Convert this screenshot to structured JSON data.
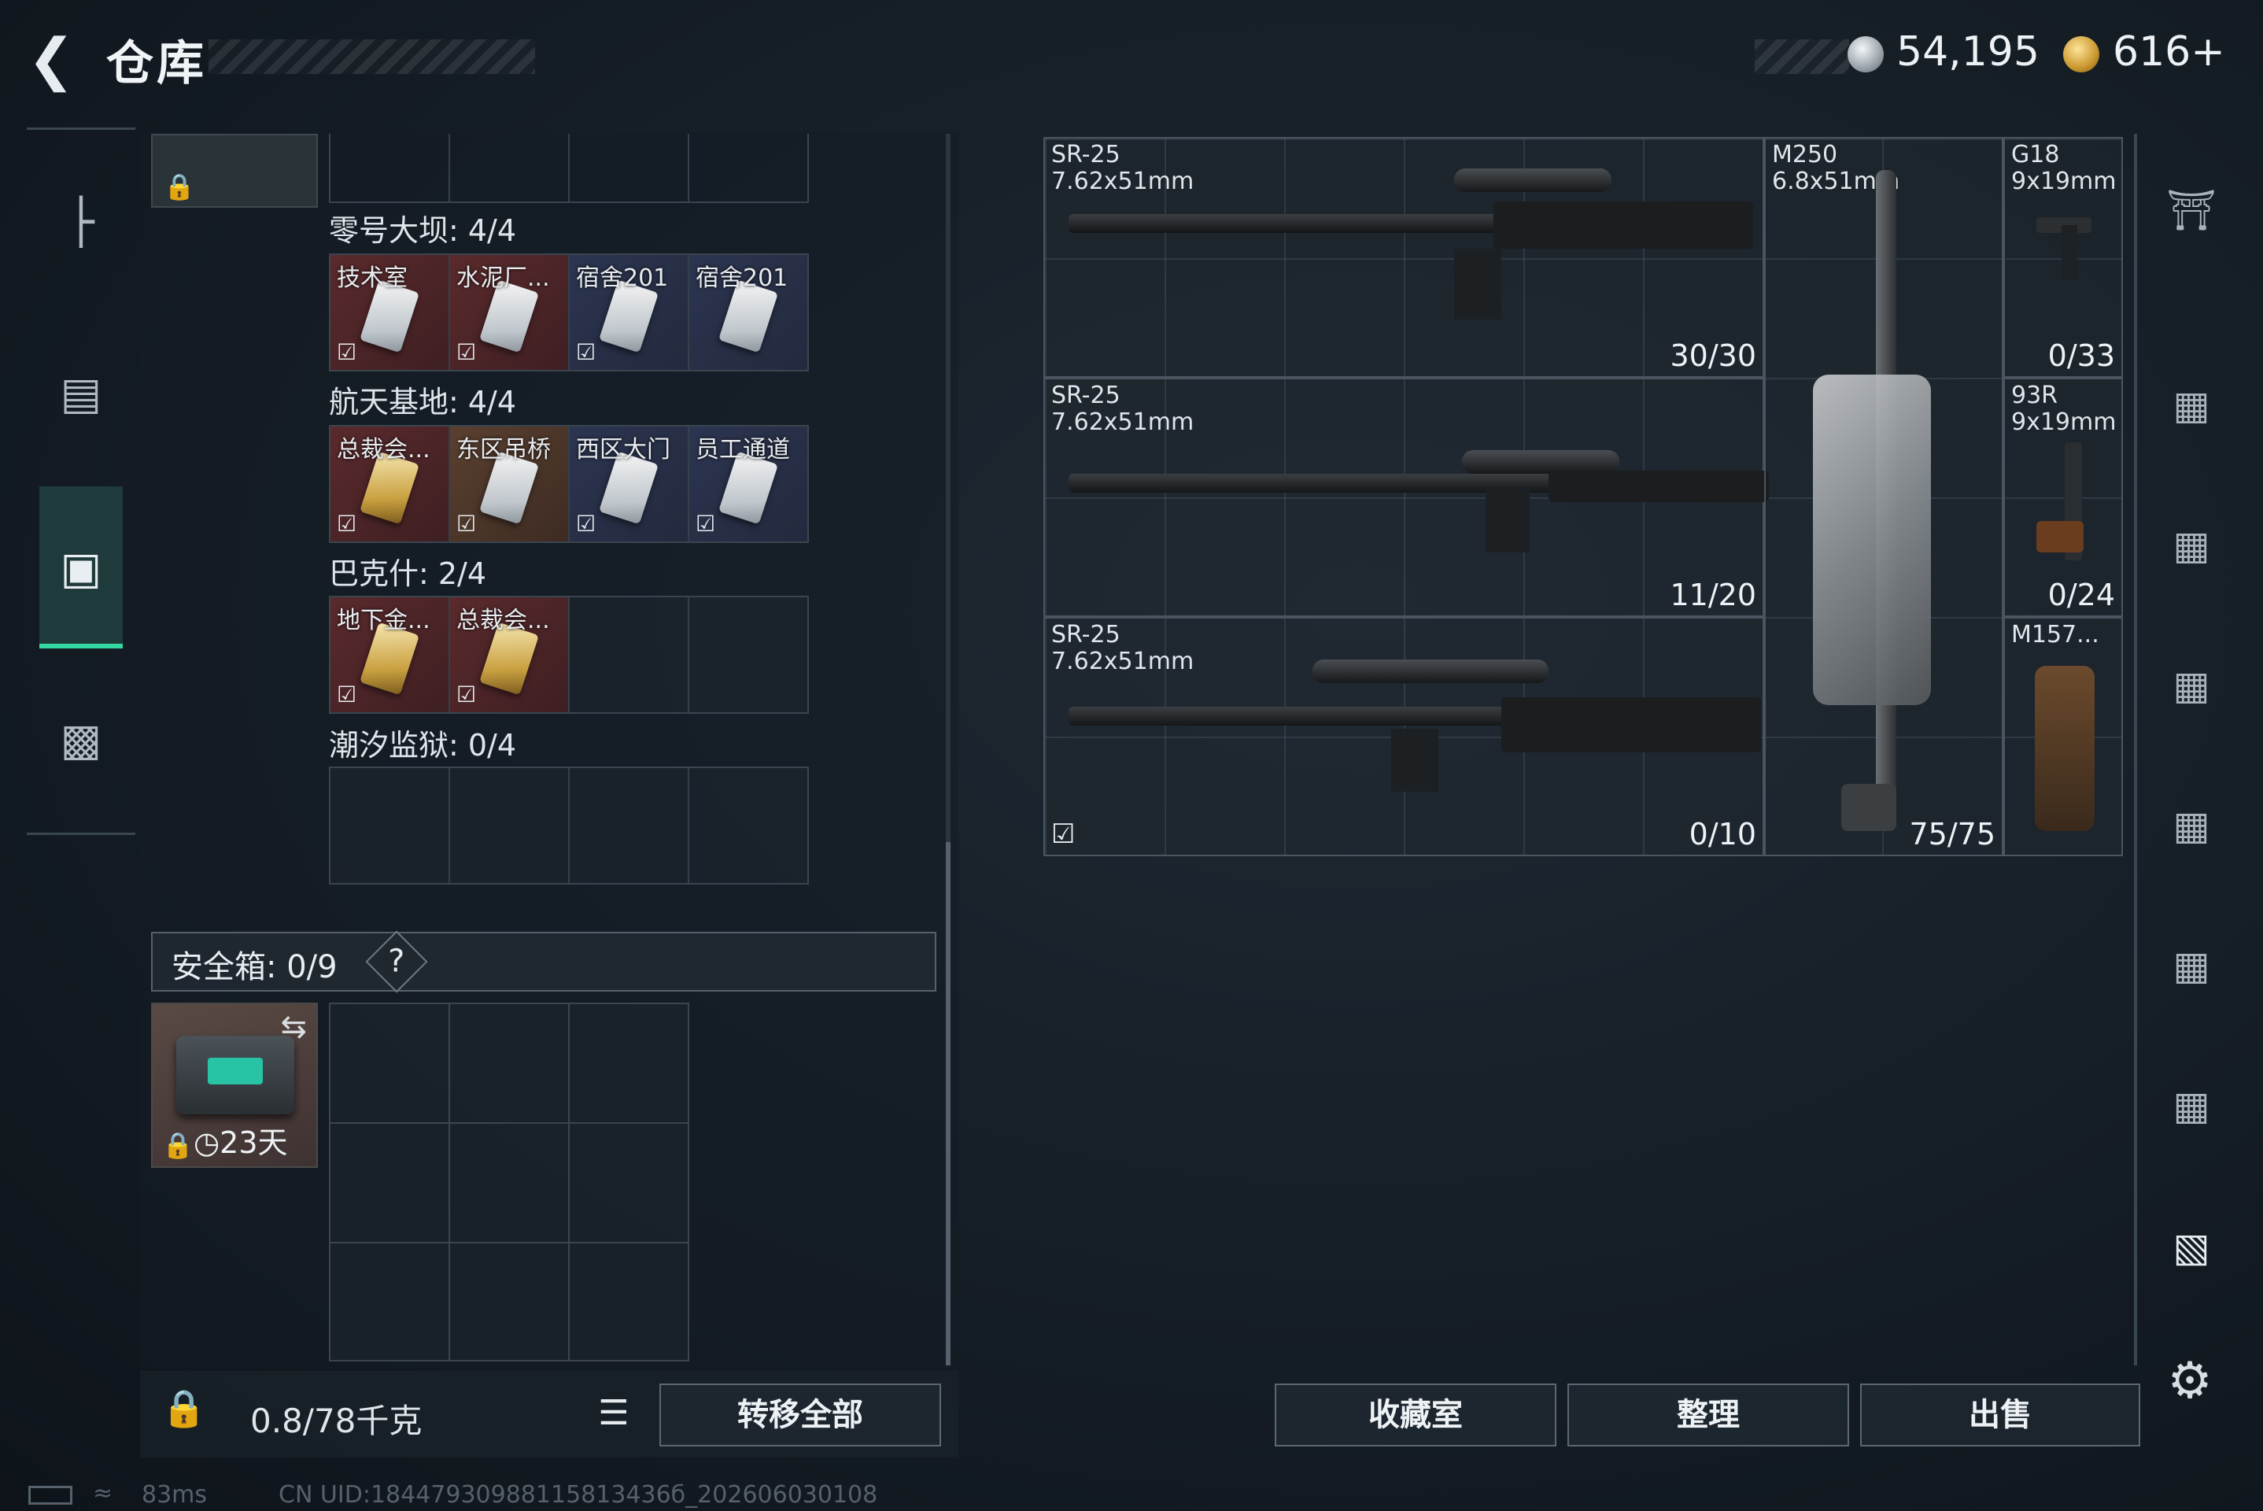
{
  "header": {
    "back_icon": "back-arrow-icon",
    "title": "仓库",
    "currency_silver": "54,195",
    "currency_gold": "616+"
  },
  "left_nav": {
    "items": [
      {
        "icon": "gun-icon"
      },
      {
        "icon": "backpack-icon"
      },
      {
        "icon": "case-icon",
        "active": true
      },
      {
        "icon": "briefcase-icon"
      }
    ]
  },
  "keycards": {
    "sections": [
      {
        "title": "零号大坝: 4/4",
        "cards": [
          {
            "label": "技术室",
            "tone": "red"
          },
          {
            "label": "水泥厂...",
            "tone": "red"
          },
          {
            "label": "宿舍201",
            "tone": "blue"
          },
          {
            "label": "宿舍201",
            "tone": "blue"
          }
        ]
      },
      {
        "title": "航天基地: 4/4",
        "cards": [
          {
            "label": "总裁会...",
            "tone": "red",
            "gold": true
          },
          {
            "label": "东区吊桥",
            "tone": "brown"
          },
          {
            "label": "西区大门",
            "tone": "blue"
          },
          {
            "label": "员工通道",
            "tone": "blue"
          }
        ]
      },
      {
        "title": "巴克什: 2/4",
        "cards": [
          {
            "label": "地下金...",
            "tone": "red",
            "gold": true
          },
          {
            "label": "总裁会...",
            "tone": "red",
            "gold": true
          }
        ]
      },
      {
        "title": "潮汐监狱: 0/4",
        "cards": []
      }
    ]
  },
  "safe": {
    "label": "安全箱:",
    "count": "0/9",
    "help": "?",
    "timer": "23天"
  },
  "bottom_left": {
    "weight": "0.8/78千克",
    "transfer_all": "转移全部"
  },
  "weapons": [
    {
      "name": "SR-25",
      "caliber": "7.62x51mm",
      "ammo": "30/30"
    },
    {
      "name": "SR-25",
      "caliber": "7.62x51mm",
      "ammo": "11/20"
    },
    {
      "name": "SR-25",
      "caliber": "7.62x51mm",
      "ammo": "0/10"
    },
    {
      "name": "M250",
      "caliber": "6.8x51mm",
      "ammo": "75/75"
    },
    {
      "name": "G18",
      "caliber": "9x19mm",
      "ammo": "0/33"
    },
    {
      "name": "93R",
      "caliber": "9x19mm",
      "ammo": "0/24"
    },
    {
      "name": "M157...",
      "caliber": "",
      "ammo": ""
    }
  ],
  "bottom_right": {
    "collection": "收藏室",
    "sort": "整理",
    "sell": "出售"
  },
  "right_nav": {
    "icons": [
      "helmet-icon",
      "armor-III-icon",
      "armor-III-icon",
      "armor-III-icon",
      "armor-IV-icon",
      "armor-III-icon",
      "armor-III-icon",
      "rig-III-icon",
      "settings-gear-icon"
    ]
  },
  "status_bar": {
    "ping": "83ms",
    "uid": "CN UID:18447930988115813436б_202606030108"
  }
}
